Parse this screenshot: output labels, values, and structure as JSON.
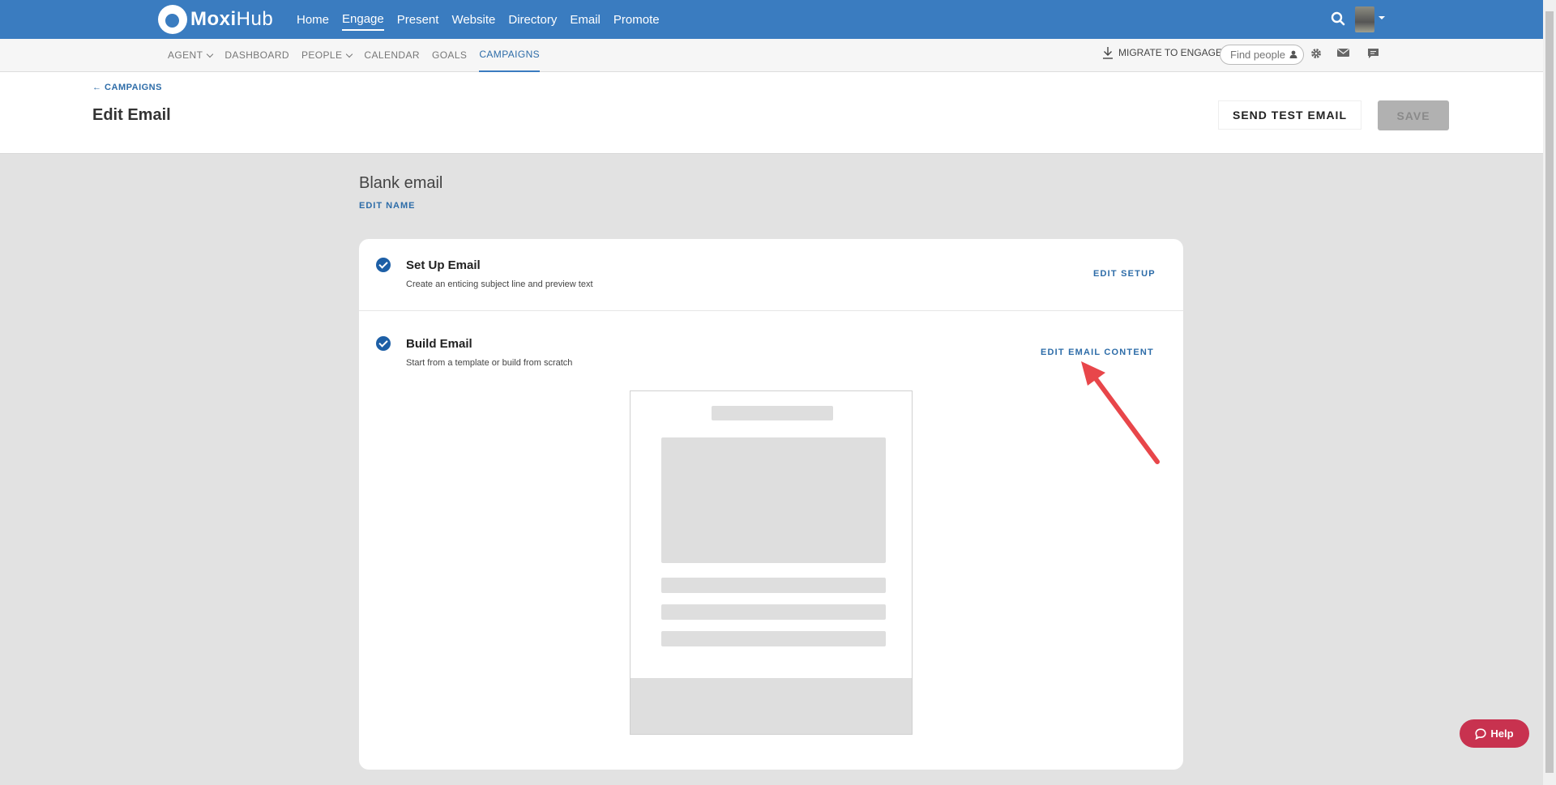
{
  "app": {
    "logo_bold": "Moxi",
    "logo_light": "Hub",
    "top_nav": [
      "Home",
      "Engage",
      "Present",
      "Website",
      "Directory",
      "Email",
      "Promote"
    ],
    "top_nav_active": "Engage"
  },
  "subnav": {
    "items": [
      {
        "label": "AGENT",
        "dropdown": true
      },
      {
        "label": "DASHBOARD",
        "dropdown": false
      },
      {
        "label": "PEOPLE",
        "dropdown": true
      },
      {
        "label": "CALENDAR",
        "dropdown": false
      },
      {
        "label": "GOALS",
        "dropdown": false
      },
      {
        "label": "CAMPAIGNS",
        "dropdown": false,
        "active": true
      }
    ],
    "migrate_label": "MIGRATE TO ENGAGE",
    "find_placeholder": "Find people"
  },
  "header": {
    "back_link": "← CAMPAIGNS",
    "title": "Edit Email",
    "send_test_label": "SEND TEST EMAIL",
    "save_label": "SAVE"
  },
  "email": {
    "name": "Blank email",
    "edit_name_label": "EDIT NAME"
  },
  "steps": [
    {
      "title": "Set Up Email",
      "description": "Create an enticing subject line and preview text",
      "action": "EDIT SETUP",
      "complete": true
    },
    {
      "title": "Build Email",
      "description": "Start from a template or build from scratch",
      "action": "EDIT EMAIL CONTENT",
      "complete": true
    }
  ],
  "help": {
    "label": "Help"
  },
  "colors": {
    "brand_blue": "#3a7cc0",
    "link_blue": "#2d6ca8",
    "check_blue": "#1d5fa6",
    "help_red": "#c8324f",
    "arrow_red": "#e8464a"
  }
}
